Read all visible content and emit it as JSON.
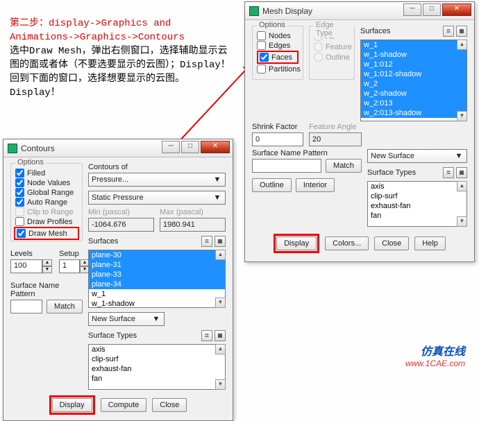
{
  "instructions": {
    "step": "第二步：",
    "path": "display->Graphics and Animations->Graphics->Contours",
    "line1": "选中Draw Mesh，弹出右侧窗口，选择辅助显示云图的面或者体（不要选要显示的云图）；Display！",
    "line2": "回到下面的窗口，选择想要显示的云图。Display！"
  },
  "mesh_dialog": {
    "title": "Mesh Display",
    "options_label": "Options",
    "options": {
      "nodes": "Nodes",
      "edges": "Edges",
      "faces": "Faces",
      "partitions": "Partitions"
    },
    "edge_type_label": "Edge Type",
    "edge_types": {
      "all": "All",
      "feature": "Feature",
      "outline": "Outline"
    },
    "shrink_label": "Shrink Factor",
    "feature_angle_label": "Feature Angle",
    "shrink_value": "0",
    "feature_angle_value": "20",
    "surface_pattern_label": "Surface Name Pattern",
    "match_btn": "Match",
    "outline_btn": "Outline",
    "interior_btn": "Interior",
    "surfaces_label": "Surfaces",
    "surfaces": [
      "w_1",
      "w_1-shadow",
      "w_1:012",
      "w_1:012-shadow",
      "w_2",
      "w_2-shadow",
      "w_2:013",
      "w_2:013-shadow"
    ],
    "new_surface_btn": "New Surface",
    "surface_types_label": "Surface Types",
    "surface_types": [
      "axis",
      "clip-surf",
      "exhaust-fan",
      "fan"
    ],
    "display_btn": "Display",
    "colors_btn": "Colors...",
    "close_btn": "Close",
    "help_btn": "Help"
  },
  "contours_dialog": {
    "title": "Contours",
    "options_label": "Options",
    "options": {
      "filled": "Filled",
      "node_values": "Node Values",
      "global_range": "Global Range",
      "auto_range": "Auto Range",
      "clip_to_range": "Clip to Range",
      "draw_profiles": "Draw Profiles",
      "draw_mesh": "Draw Mesh"
    },
    "contours_of_label": "Contours of",
    "contours_of_value": "Pressure...",
    "sub_value": "Static Pressure",
    "min_label": "Min (pascal)",
    "max_label": "Max (pascal)",
    "min_value": "-1064.676",
    "max_value": "1980.941",
    "levels_label": "Levels",
    "setup_label": "Setup",
    "levels_value": "100",
    "setup_value": "1",
    "surfaces_label": "Surfaces",
    "surfaces": [
      "plane-30",
      "plane-31",
      "plane-33",
      "plane-34",
      "w_1",
      "w_1-shadow"
    ],
    "surface_pattern_label": "Surface Name Pattern",
    "match_btn": "Match",
    "new_surface_btn": "New Surface",
    "surface_types_label": "Surface Types",
    "surface_types": [
      "axis",
      "clip-surf",
      "exhaust-fan",
      "fan"
    ],
    "display_btn": "Display",
    "compute_btn": "Compute",
    "close_btn": "Close"
  },
  "footer": {
    "brand": "仿真在线",
    "url": "www.1CAE.com"
  },
  "icons": {
    "up": "▲",
    "down": "▼",
    "list": "≣",
    "grid": "▦",
    "min": "─",
    "max": "□",
    "close": "✕",
    "dd": "▼"
  }
}
